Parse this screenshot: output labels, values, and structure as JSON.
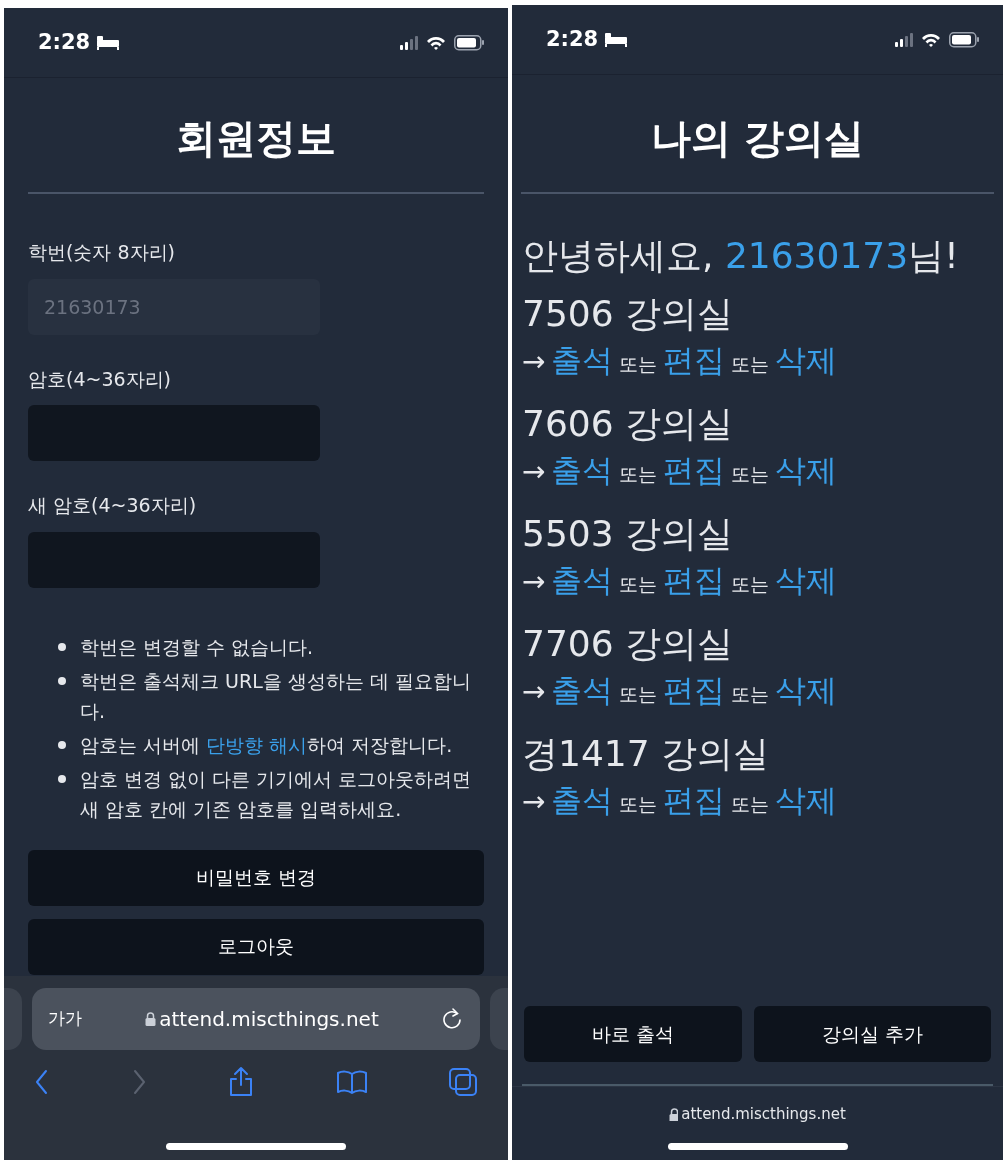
{
  "left_screen": {
    "status_bar": {
      "time": "2:28"
    },
    "title": "회원정보",
    "fields": [
      {
        "label": "학번(숫자 8자리)",
        "value": "21630173",
        "disabled": true
      },
      {
        "label": "암호(4~36자리)",
        "disabled": false
      },
      {
        "label": "새 암호(4~36자리)",
        "disabled": false
      }
    ],
    "notes": [
      {
        "parts": [
          {
            "kind": "text",
            "text": "학번은 변경할 수 없습니다."
          }
        ]
      },
      {
        "parts": [
          {
            "kind": "text",
            "text": "학번은 출석체크 URL을 생성하는 데 필요합니다."
          }
        ]
      },
      {
        "parts": [
          {
            "kind": "text",
            "text": "암호는 서버에 "
          },
          {
            "kind": "link",
            "text": "단방향 해시"
          },
          {
            "kind": "text",
            "text": "하여 저장합니다."
          }
        ]
      },
      {
        "parts": [
          {
            "kind": "text",
            "text": "암호 변경 없이 다른 기기에서 로그아웃하려면 새 암호 칸에 기존 암호를 입력하세요."
          }
        ]
      }
    ],
    "buttons": [
      "비밀번호 변경",
      "로그아웃"
    ],
    "browser_bar": {
      "text_size": "가가",
      "url": "attend.miscthings.net"
    }
  },
  "right_screen": {
    "status_bar": {
      "time": "2:28"
    },
    "title": "나의 강의실",
    "greeting": [
      {
        "kind": "text",
        "text": "안녕하세요, "
      },
      {
        "kind": "link",
        "text": "21630173"
      },
      {
        "kind": "text",
        "text": "님!"
      }
    ],
    "classrooms": [
      {
        "name": "7506 강의실",
        "actions": [
          {
            "kind": "arrow",
            "text": "→"
          },
          {
            "kind": "link",
            "text": "출석"
          },
          {
            "kind": "word",
            "text": "또는"
          },
          {
            "kind": "link",
            "text": "편집"
          },
          {
            "kind": "word",
            "text": "또는"
          },
          {
            "kind": "link",
            "text": "삭제"
          }
        ]
      },
      {
        "name": "7606 강의실",
        "actions": [
          {
            "kind": "arrow",
            "text": "→"
          },
          {
            "kind": "link",
            "text": "출석"
          },
          {
            "kind": "word",
            "text": "또는"
          },
          {
            "kind": "link",
            "text": "편집"
          },
          {
            "kind": "word",
            "text": "또는"
          },
          {
            "kind": "link",
            "text": "삭제"
          }
        ]
      },
      {
        "name": "5503 강의실",
        "actions": [
          {
            "kind": "arrow",
            "text": "→"
          },
          {
            "kind": "link",
            "text": "출석"
          },
          {
            "kind": "word",
            "text": "또는"
          },
          {
            "kind": "link",
            "text": "편집"
          },
          {
            "kind": "word",
            "text": "또는"
          },
          {
            "kind": "link",
            "text": "삭제"
          }
        ]
      },
      {
        "name": "7706 강의실",
        "actions": [
          {
            "kind": "arrow",
            "text": "→"
          },
          {
            "kind": "link",
            "text": "출석"
          },
          {
            "kind": "word",
            "text": "또는"
          },
          {
            "kind": "link",
            "text": "편집"
          },
          {
            "kind": "word",
            "text": "또는"
          },
          {
            "kind": "link",
            "text": "삭제"
          }
        ]
      },
      {
        "name": "경1417 강의실",
        "actions": [
          {
            "kind": "arrow",
            "text": "→"
          },
          {
            "kind": "link",
            "text": "출석"
          },
          {
            "kind": "word",
            "text": "또는"
          },
          {
            "kind": "link",
            "text": "편집"
          },
          {
            "kind": "word",
            "text": "또는"
          },
          {
            "kind": "link",
            "text": "삭제"
          }
        ]
      }
    ],
    "buttons": [
      "바로 출석",
      "강의실 추가"
    ],
    "url": "attend.miscthings.net"
  }
}
